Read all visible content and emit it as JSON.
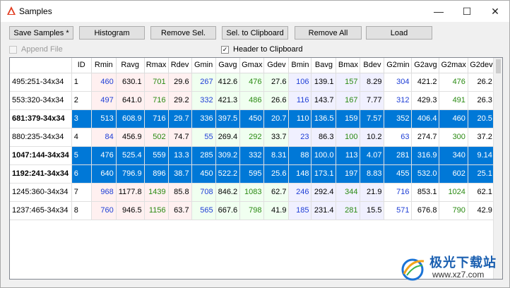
{
  "window": {
    "title": "Samples"
  },
  "toolbar": {
    "save_samples": "Save Samples *",
    "histogram": "Histogram",
    "remove_sel": "Remove Sel.",
    "sel_to_clipboard": "Sel. to Clipboard",
    "remove_all": "Remove All",
    "load": "Load"
  },
  "options": {
    "append_file": {
      "label": "Append File",
      "checked": false,
      "enabled": false
    },
    "header_to_clipboard": {
      "label": "Header to Clipboard",
      "checked": true
    }
  },
  "table": {
    "columns": [
      "ID",
      "Rmin",
      "Ravg",
      "Rmax",
      "Rdev",
      "Gmin",
      "Gavg",
      "Gmax",
      "Gdev",
      "Bmin",
      "Bavg",
      "Bmax",
      "Bdev",
      "G2min",
      "G2avg",
      "G2max",
      "G2dev"
    ],
    "rows": [
      {
        "label": "495:251-34x34",
        "selected": false,
        "values": [
          "1",
          "460",
          "630.1",
          "701",
          "29.6",
          "267",
          "412.6",
          "476",
          "27.6",
          "106",
          "139.1",
          "157",
          "8.29",
          "304",
          "421.2",
          "476",
          "26.2"
        ]
      },
      {
        "label": "553:320-34x34",
        "selected": false,
        "values": [
          "2",
          "497",
          "641.0",
          "716",
          "29.2",
          "332",
          "421.3",
          "486",
          "26.6",
          "116",
          "143.7",
          "167",
          "7.77",
          "312",
          "429.3",
          "491",
          "26.3"
        ]
      },
      {
        "label": "681:379-34x34",
        "selected": true,
        "values": [
          "3",
          "513",
          "608.9",
          "716",
          "29.7",
          "336",
          "397.5",
          "450",
          "20.7",
          "110",
          "136.5",
          "159",
          "7.57",
          "352",
          "406.4",
          "460",
          "20.5"
        ]
      },
      {
        "label": "880:235-34x34",
        "selected": false,
        "values": [
          "4",
          "84",
          "456.9",
          "502",
          "74.7",
          "55",
          "269.4",
          "292",
          "33.7",
          "23",
          "86.3",
          "100",
          "10.2",
          "63",
          "274.7",
          "300",
          "37.2"
        ]
      },
      {
        "label": "1047:144-34x34",
        "selected": true,
        "values": [
          "5",
          "476",
          "525.4",
          "559",
          "13.3",
          "285",
          "309.2",
          "332",
          "8.31",
          "88",
          "100.0",
          "113",
          "4.07",
          "281",
          "316.9",
          "340",
          "9.14"
        ]
      },
      {
        "label": "1192:241-34x34",
        "selected": true,
        "values": [
          "6",
          "640",
          "796.9",
          "896",
          "38.7",
          "450",
          "522.2",
          "595",
          "25.6",
          "148",
          "173.1",
          "197",
          "8.83",
          "455",
          "532.0",
          "602",
          "25.1"
        ]
      },
      {
        "label": "1245:360-34x34",
        "selected": false,
        "values": [
          "7",
          "968",
          "1177.8",
          "1439",
          "85.8",
          "708",
          "846.2",
          "1083",
          "62.7",
          "246",
          "292.4",
          "344",
          "21.9",
          "716",
          "853.1",
          "1024",
          "62.1"
        ]
      },
      {
        "label": "1237:465-34x34",
        "selected": false,
        "values": [
          "8",
          "760",
          "946.5",
          "1156",
          "63.7",
          "565",
          "667.6",
          "798",
          "41.9",
          "185",
          "231.4",
          "281",
          "15.5",
          "571",
          "676.8",
          "790",
          "42.9"
        ]
      }
    ]
  },
  "watermark": {
    "cn_text": "极光下载站",
    "url": "www.xz7.com"
  },
  "colors": {
    "selection": "#0078d7",
    "min_value": "#1f3fd6",
    "max_value": "#2a8a12"
  }
}
